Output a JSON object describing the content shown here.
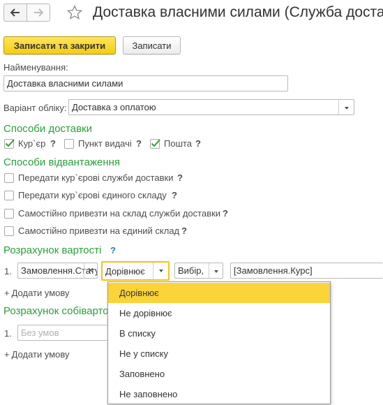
{
  "header": {
    "title": "Доставка власними силами (Служба доставки)"
  },
  "toolbar": {
    "save_close_label": "Записати та закрити",
    "save_label": "Записати"
  },
  "form": {
    "name_label": "Найменування:",
    "name_value": "Доставка власними силами",
    "account_variant_label": "Варіант обліку:",
    "account_variant_value": "Доставка з оплатою"
  },
  "delivery_methods": {
    "title": "Способи доставки",
    "help": "?",
    "items": [
      {
        "label": "Кур`єр",
        "checked": true
      },
      {
        "label": "Пункт видачі",
        "checked": false
      },
      {
        "label": "Пошта",
        "checked": true
      }
    ]
  },
  "shipment_methods": {
    "title": "Способи відвантаження",
    "help": "?",
    "items": [
      {
        "label": "Передати кур`єрові служби доставки",
        "checked": false
      },
      {
        "label": "Передати кур`єрові єдиного складу",
        "checked": false
      },
      {
        "label": "Самостійно привезти на склад служби доставки",
        "checked": false
      },
      {
        "label": "Самостійно привезти на єдиний склад",
        "checked": false
      }
    ]
  },
  "cost_calc": {
    "title": "Розрахунок вартості",
    "help": "?",
    "row_number": "1.",
    "field_value": "Замовлення.Статус",
    "operator_value": "Дорівнює",
    "choice_value": "Вибір,",
    "expression_value": "[Замовлення.Курс]",
    "add_condition": "Додати умову"
  },
  "cost_calc2": {
    "title": "Розрахунок собівартості",
    "row_number": "1.",
    "placeholder": "Без умов",
    "add_condition": "Додати умову"
  },
  "operator_dropdown": {
    "options": [
      "Дорівнює",
      "Не дорівнює",
      "В списку",
      "Не у списку",
      "Заповнено",
      "Не заповнено"
    ],
    "selected": "Дорівнює"
  },
  "icons": {
    "back": "arrow-left-icon",
    "forward": "arrow-right-icon",
    "favorite": "star-icon",
    "dropdown": "chevron-down-icon",
    "clear": "close-icon",
    "check": "checkmark-icon"
  },
  "colors": {
    "accent_section": "#2aa03a",
    "primary_button": "#f5cd10",
    "dropdown_highlight": "#fbd43a",
    "help": "#2a7ab8"
  }
}
